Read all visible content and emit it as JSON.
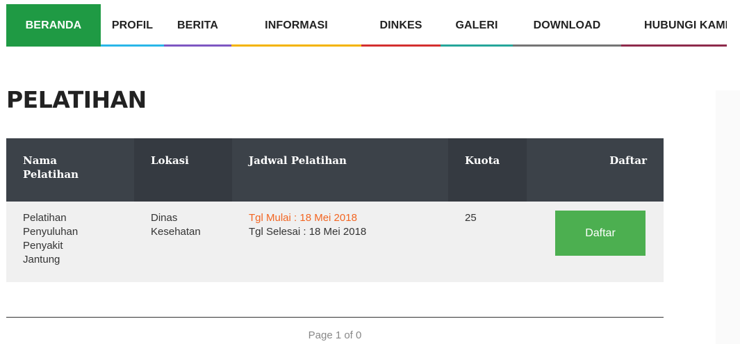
{
  "nav": {
    "items": [
      {
        "label": "BERANDA",
        "color": "#1f9a44",
        "active": true
      },
      {
        "label": "PROFIL",
        "color": "#29b6e8"
      },
      {
        "label": "BERITA",
        "color": "#7e57c2"
      },
      {
        "label": "INFORMASI",
        "color": "#f4b400"
      },
      {
        "label": "DINKES",
        "color": "#d32f2f"
      },
      {
        "label": "GALERI",
        "color": "#26a69a"
      },
      {
        "label": "DOWNLOAD",
        "color": "#757575"
      },
      {
        "label": "HUBUNGI KAMI",
        "color": "#8e2a4b"
      }
    ]
  },
  "page": {
    "title": "PELATIHAN"
  },
  "table": {
    "headers": {
      "nama_line1": "Nama",
      "nama_line2": "Pelatihan",
      "lokasi": "Lokasi",
      "jadwal": "Jadwal Pelatihan",
      "kuota": "Kuota",
      "daftar": "Daftar"
    },
    "rows": [
      {
        "nama": [
          "Pelatihan",
          "Penyuluhan",
          "Penyakit",
          "Jantung"
        ],
        "lokasi": [
          "Dinas",
          "Kesehatan"
        ],
        "tgl_mulai": "Tgl Mulai : 18 Mei 2018",
        "tgl_selesai": "Tgl Selesai : 18 Mei 2018",
        "kuota": "25",
        "button_label": "Daftar"
      }
    ]
  },
  "pager": {
    "text": "Page 1 of 0"
  },
  "colors": {
    "header_bg": "#3c4249",
    "row_bg": "#f0f0f0",
    "button_bg": "#4caf50",
    "schedule_start": "#f26522"
  }
}
